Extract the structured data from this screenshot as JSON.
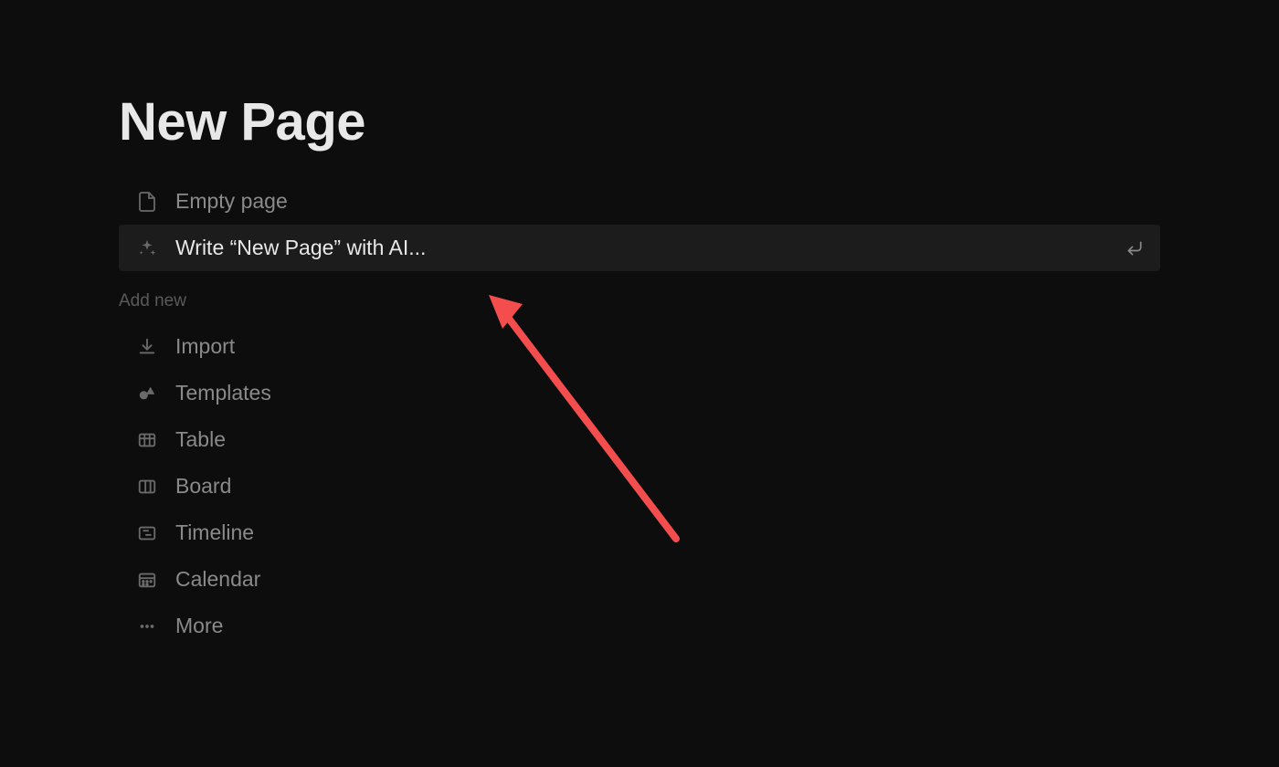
{
  "title": "New Page",
  "options": {
    "empty_page": "Empty page",
    "ai_write": "Write “New Page” with AI..."
  },
  "section_header": "Add new",
  "add_new": {
    "import": "Import",
    "templates": "Templates",
    "table": "Table",
    "board": "Board",
    "timeline": "Timeline",
    "calendar": "Calendar",
    "more": "More"
  },
  "colors": {
    "annotation_arrow": "#f44d4d"
  }
}
